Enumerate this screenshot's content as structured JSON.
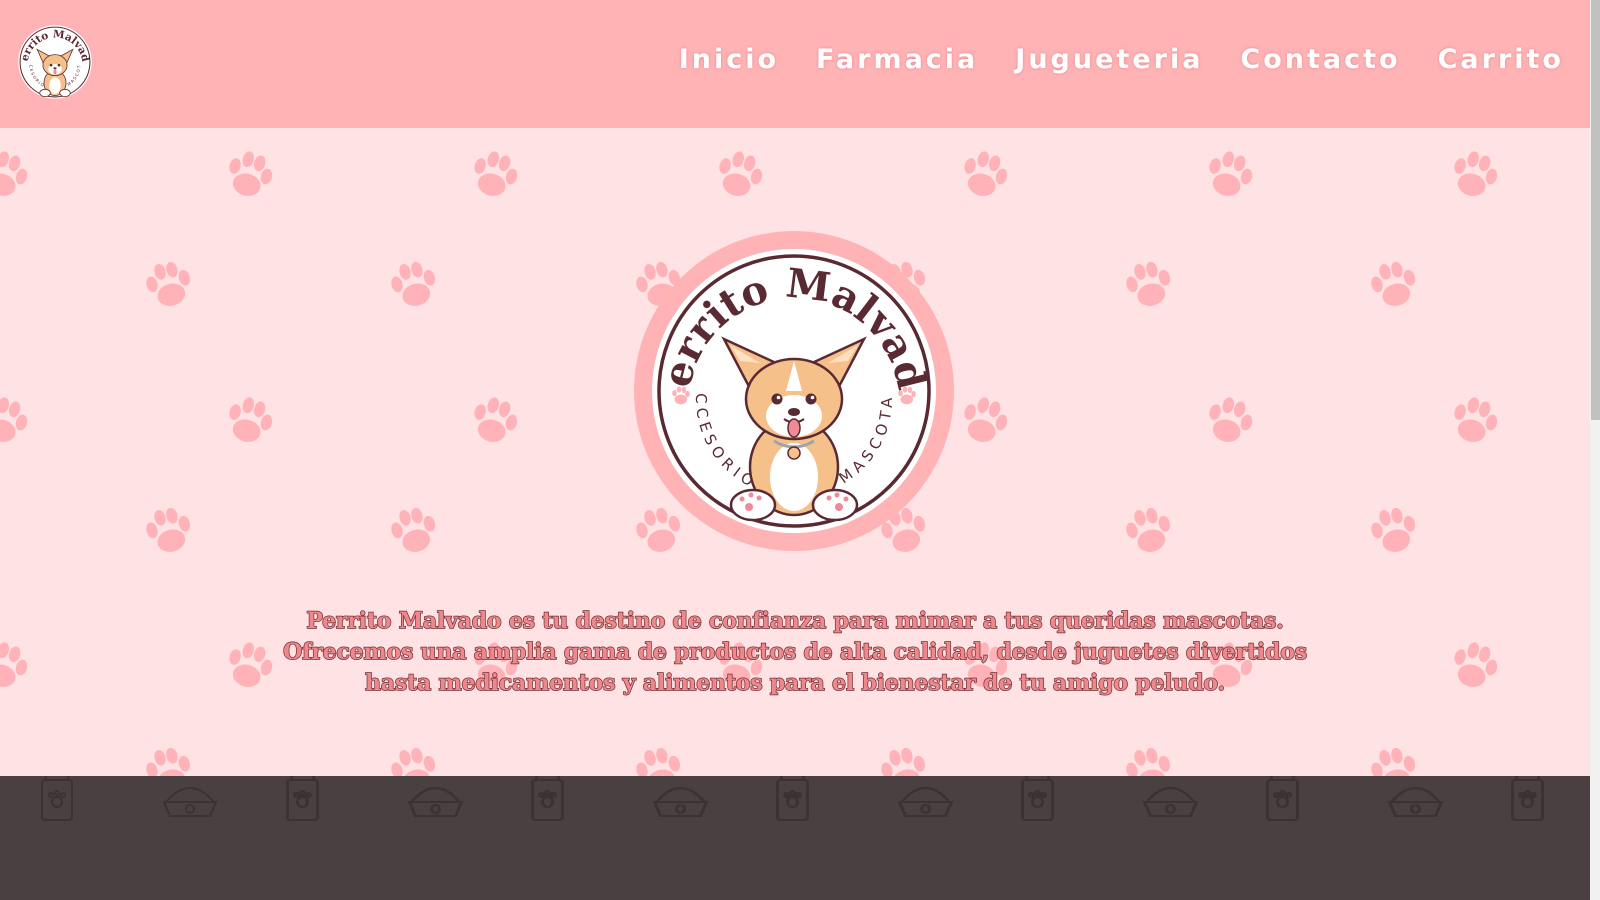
{
  "navbar": {
    "logo": {
      "title": "Perrito Malvado",
      "subtitle": "ACCESORIOS PARA MASCOTAS",
      "icon": "corgi-dog-icon"
    },
    "links": [
      "Inicio",
      "Farmacia",
      "Jugueteria",
      "Contacto",
      "Carrito"
    ]
  },
  "hero": {
    "logo": {
      "title": "Perrito Malvado",
      "subtitle": "ACCESORIOS PARA MASCOTAS",
      "icon": "corgi-dog-icon"
    },
    "description": "Perrito Malvado es tu destino de confianza para mimar a tus queridas mascotas. Ofrecemos una amplia gama de productos de alta calidad, desde juguetes divertidos hasta medicamentos y alimentos para el bienestar de tu amigo peludo.",
    "background_icon": "paw-print-icon"
  },
  "footer": {
    "background_icons": [
      "food-bag-icon",
      "food-bowl-icon"
    ]
  },
  "colors": {
    "navbar": "#ffb3b5",
    "hero_background": "#ffe2e4",
    "paw": "#ffb3b8",
    "text_fill": "#f0888b",
    "text_outline": "#6b2c33",
    "footer": "#4a4041",
    "logo_ring": "#ffb3b5",
    "logo_border": "#5a2a33"
  }
}
